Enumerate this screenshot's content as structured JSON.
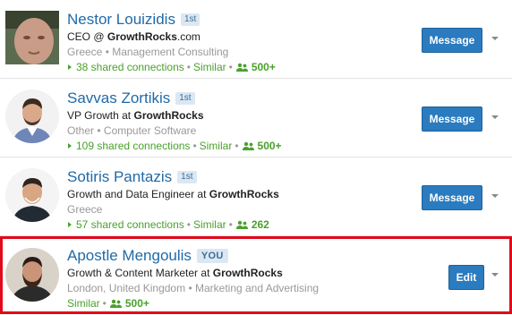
{
  "people": [
    {
      "name": "Nestor Louizidis",
      "degree": "1st",
      "headline_prefix": "CEO @ ",
      "headline_company": "GrowthRocks",
      "headline_suffix": ".com",
      "location": "Greece",
      "industry": "Management Consulting",
      "shared_connections": "38 shared connections",
      "similar": "Similar",
      "connections": "500+",
      "action": "Message",
      "avatar_style": "photo-square",
      "avatar_icon": "profile-photo-icon"
    },
    {
      "name": "Savvas Zortikis",
      "degree": "1st",
      "headline_prefix": "VP Growth at ",
      "headline_company": "GrowthRocks",
      "headline_suffix": "",
      "location": "Other",
      "industry": "Computer Software",
      "shared_connections": "109 shared connections",
      "similar": "Similar",
      "connections": "500+",
      "action": "Message",
      "avatar_style": "photo-round",
      "avatar_icon": "profile-photo-icon"
    },
    {
      "name": "Sotiris Pantazis",
      "degree": "1st",
      "headline_prefix": "Growth and Data Engineer at ",
      "headline_company": "GrowthRocks",
      "headline_suffix": "",
      "location": "Greece",
      "industry": "",
      "shared_connections": "57 shared connections",
      "similar": "Similar",
      "connections": "262",
      "action": "Message",
      "avatar_style": "photo-round",
      "avatar_icon": "profile-photo-icon"
    },
    {
      "name": "Apostle Mengoulis",
      "degree": "YOU",
      "headline_prefix": "Growth & Content Marketer at ",
      "headline_company": "GrowthRocks",
      "headline_suffix": "",
      "location": "London, United Kingdom",
      "industry": "Marketing and Advertising",
      "shared_connections": "",
      "similar": "Similar",
      "connections": "500+",
      "action": "Edit",
      "avatar_style": "photo-round",
      "avatar_icon": "profile-photo-icon"
    }
  ],
  "colors": {
    "link_blue": "#1f6aa8",
    "button_blue": "#2a7bbf",
    "green": "#4aa12b",
    "muted": "#999999",
    "highlight_red": "#e3081b",
    "badge_bg": "#dbe8f3"
  },
  "icons": {
    "bullet": "triangle-right-icon",
    "connections": "people-icon",
    "dropdown": "caret-down-icon",
    "separator": "•"
  }
}
